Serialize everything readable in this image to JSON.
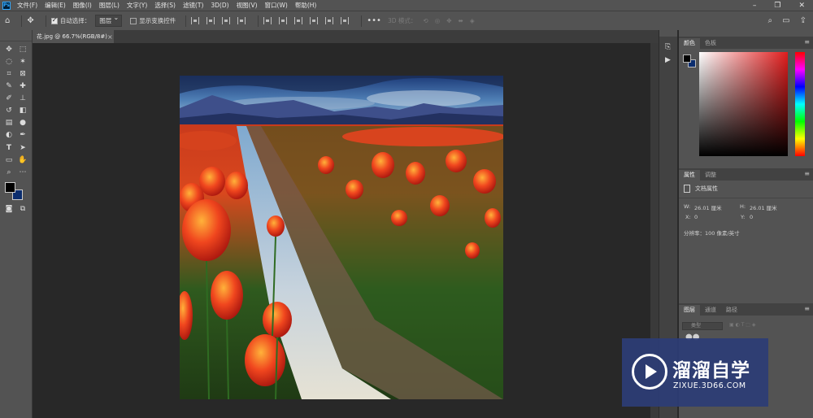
{
  "menubar": {
    "app_logo": "Ps",
    "items": [
      "文件(F)",
      "编辑(E)",
      "图像(I)",
      "图层(L)",
      "文字(Y)",
      "选择(S)",
      "滤镜(T)",
      "3D(D)",
      "视图(V)",
      "窗口(W)",
      "帮助(H)"
    ],
    "window_controls": [
      "–",
      "❐",
      "✕"
    ]
  },
  "optionsbar": {
    "auto_select_label": "自动选择：",
    "auto_select_value": "图层",
    "show_transform_label": "显示变换控件",
    "mode_3d_label": "3D 模式："
  },
  "document_tab": {
    "title": "花.jpg @ 66.7%(RGB/8#)",
    "close": "×"
  },
  "color_panel": {
    "tab_color": "颜色",
    "tab_swatches": "色板",
    "foreground": "#000000",
    "background": "#0b2d6e"
  },
  "properties_panel": {
    "tab_properties": "属性",
    "tab_adjustments": "调整",
    "doc_label": "文档属性",
    "w_label": "W:",
    "w_value": "26.01 厘米",
    "h_label": "H:",
    "h_value": "26.01 厘米",
    "x_label": "X:",
    "x_value": "0",
    "y_label": "Y:",
    "y_value": "0",
    "resolution": "分辨率：100 像素/英寸"
  },
  "layers_panel": {
    "tab_layers": "图层",
    "tab_channels": "通道",
    "tab_paths": "路径",
    "search_placeholder": "类型"
  },
  "watermark": {
    "title": "溜溜自学",
    "subtitle": "ZIXUE.3D66.COM"
  },
  "colors": {
    "ui_panel": "#535353",
    "canvas_bg": "#282828",
    "watermark_bg": "#2c3d76"
  }
}
